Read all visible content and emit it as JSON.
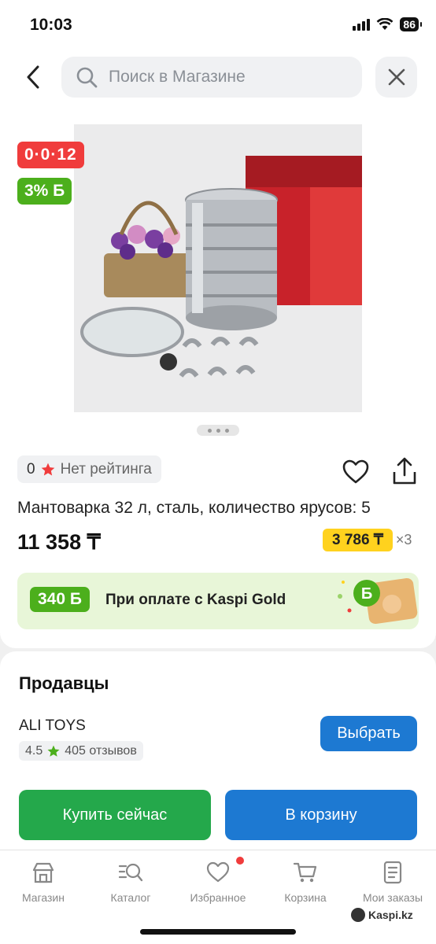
{
  "status_bar": {
    "time": "10:03",
    "battery": "86"
  },
  "search": {
    "placeholder": "Поиск в Магазине"
  },
  "product": {
    "promo_timer": "0·0·12",
    "promo_bonus": "3% Б",
    "rating_value": "0",
    "rating_text": "Нет рейтинга",
    "title": "Мантоварка 32 л, сталь, количество ярусов: 5",
    "price": "11 358 ₸",
    "installment_amount": "3 786 ₸",
    "installment_multiplier": "×3",
    "gallery_pages": 3,
    "gallery_active": 0
  },
  "gold_banner": {
    "bonus": "340 Б",
    "text": "При оплате с Kaspi Gold"
  },
  "sellers": {
    "title": "Продавцы",
    "seller_name": "ALI TOYS",
    "seller_rating": "4.5",
    "seller_reviews": "405 отзывов",
    "choose_label": "Выбрать"
  },
  "actions": {
    "buy_now": "Купить сейчас",
    "to_cart": "В корзину"
  },
  "tabbar": {
    "items": [
      {
        "label": "Магазин",
        "icon": "shop-icon"
      },
      {
        "label": "Каталог",
        "icon": "catalog-icon"
      },
      {
        "label": "Избранное",
        "icon": "heart-icon"
      },
      {
        "label": "Корзина",
        "icon": "cart-icon"
      },
      {
        "label": "Мои заказы",
        "icon": "orders-icon"
      }
    ]
  },
  "watermark": "Kaspi.kz",
  "colors": {
    "accent_blue": "#1d79d2",
    "accent_green": "#24a84b",
    "promo_red": "#f03c3c",
    "bonus_green": "#4caf1c",
    "installment_yellow": "#ffd21e"
  }
}
